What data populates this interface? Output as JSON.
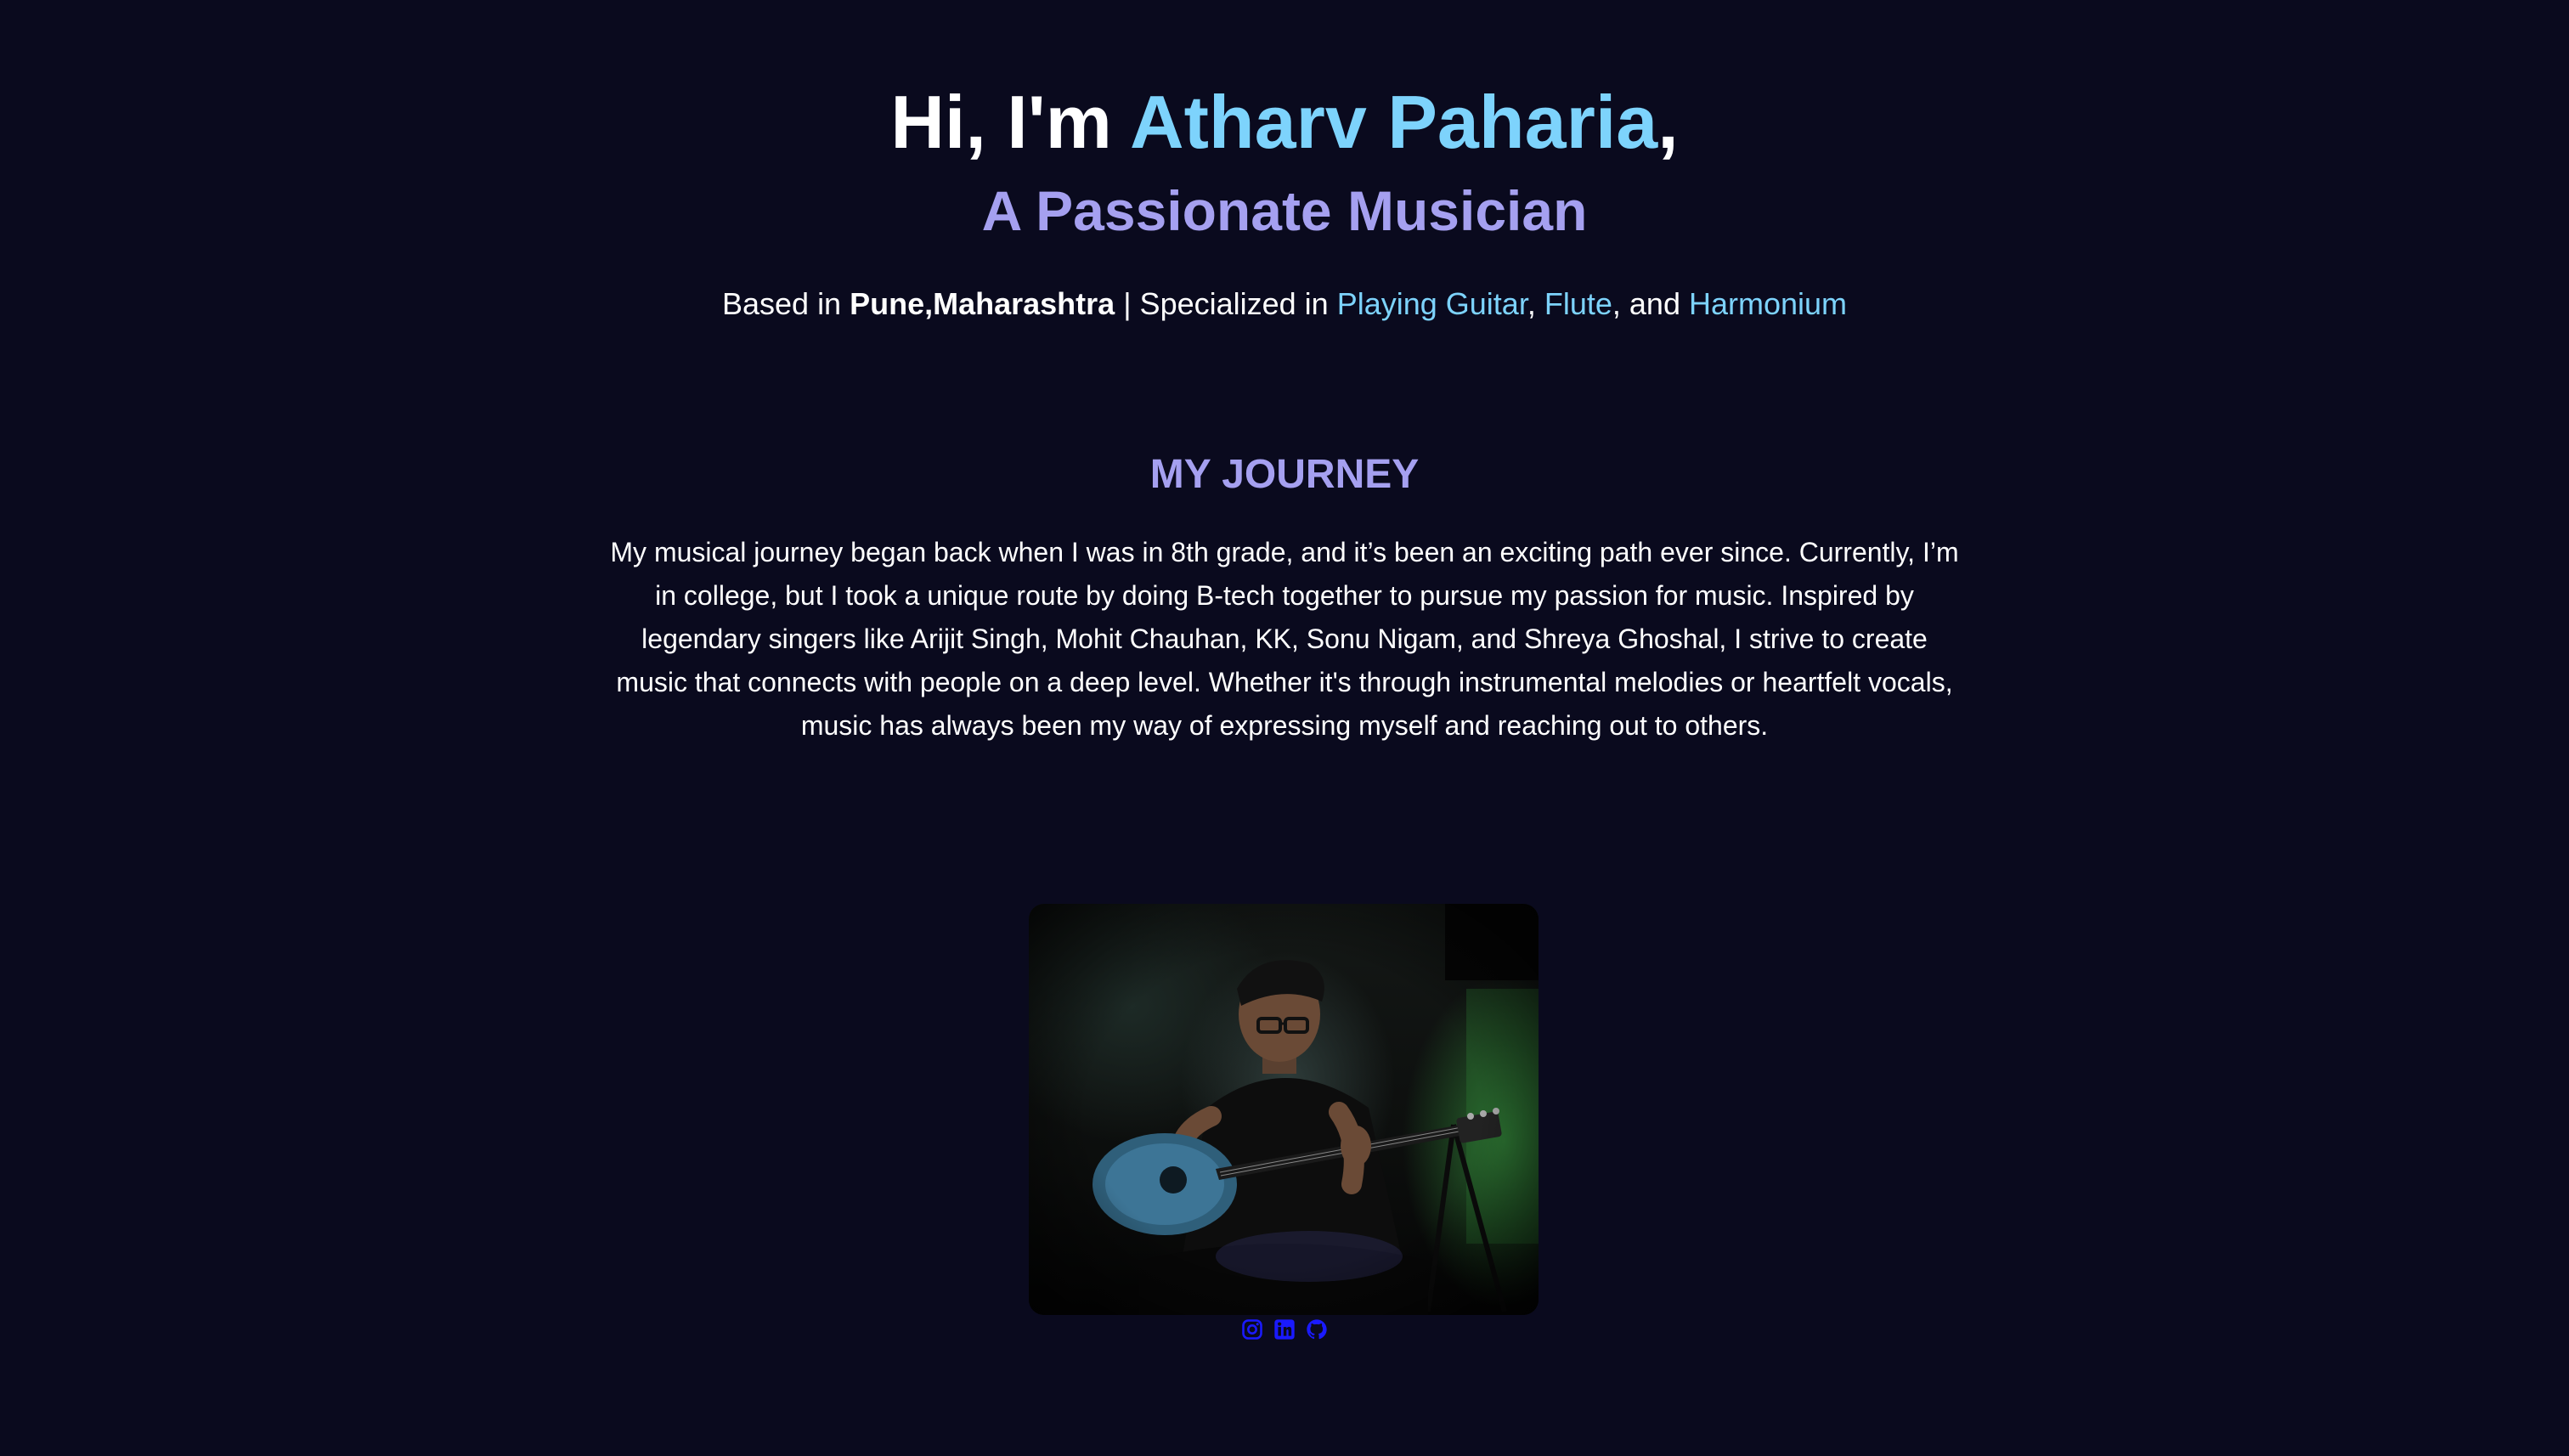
{
  "hero": {
    "greeting": "Hi, I'm ",
    "name": "Atharv Paharia",
    "comma": ",",
    "subtitle": "A Passionate Musician",
    "based_prefix": "Based in ",
    "location": "Pune,Maharashtra",
    "specialized_prefix": " | Specialized in ",
    "skills": [
      "Playing Guitar",
      "Flute",
      "Harmonium"
    ],
    "skill_sep_1": ", ",
    "skill_sep_2": ", and "
  },
  "journey": {
    "title": "MY JOURNEY",
    "text": "My musical journey began back when I was in 8th grade, and it’s been an exciting path ever since. Currently, I’m in college, but I took a unique route by doing B-tech together to pursue my passion for music. Inspired by legendary singers like Arijit Singh, Mohit Chauhan, KK, Sonu Nigam, and Shreya Ghoshal, I strive to create music that connects with people on a deep level. Whether it's through instrumental melodies or heartfelt vocals, music has always been my way of expressing myself and reaching out to others."
  },
  "photo": {
    "description_icon": "musician-playing-guitar-photo"
  },
  "social": {
    "icons": [
      "instagram-icon",
      "linkedin-icon",
      "github-icon"
    ],
    "color": "#1a1aff"
  },
  "colors": {
    "background": "#0a0a1e",
    "accent_cyan": "#7dd3fc",
    "accent_lavender": "#a5a0f0",
    "text": "#ffffff"
  }
}
